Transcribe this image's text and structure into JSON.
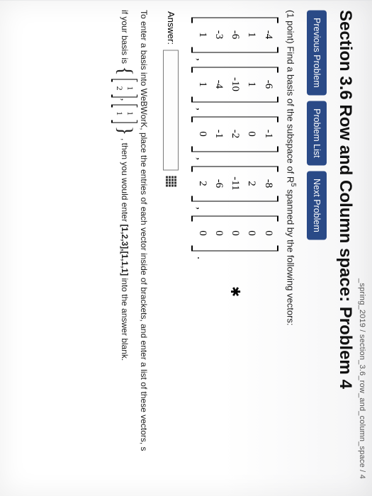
{
  "breadcrumb": "_spring_2019 / section_3.6_row_and_column_space / 4",
  "heading": "Section 3.6 Row and Column space: Problem 4",
  "nav": {
    "prev": "Previous Problem",
    "list": "Problem List",
    "next": "Next Problem"
  },
  "prompt_prefix": "(1 point) Find a basis of the subspace of ",
  "prompt_space_base": "R",
  "prompt_space_exp": "5",
  "prompt_suffix": " spanned by the following vectors:",
  "vectors": [
    [
      "-4",
      "1",
      "-6",
      "-3",
      "1"
    ],
    [
      "-6",
      "1",
      "-10",
      "-4",
      "1"
    ],
    [
      "-1",
      "0",
      "-2",
      "-1",
      "0"
    ],
    [
      "-8",
      "2",
      "-11",
      "-6",
      "2"
    ],
    [
      "0",
      "0",
      "0",
      "0",
      "0"
    ]
  ],
  "answer_label": "Answer:",
  "answer_value": "",
  "hint_line1": "To enter a basis into WeBWorK, place the entries of each vector inside of brackets, and enter a list of these vectors, s",
  "hint_line2_prefix": "if your basis is ",
  "example_vectors": [
    [
      "1",
      "2"
    ],
    [
      "1",
      "1"
    ]
  ],
  "hint_line2_mid": ", then you would enter ",
  "hint_answer": "[1,2,3],[1,1,1]",
  "hint_line2_suffix": " into the answer blank."
}
